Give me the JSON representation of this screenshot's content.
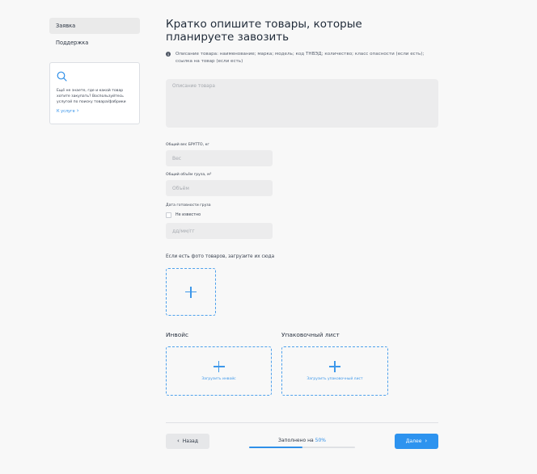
{
  "sidebar": {
    "items": [
      {
        "label": "Заявка"
      },
      {
        "label": "Поддержка"
      }
    ],
    "promo": {
      "icon": "search-icon",
      "text": "Ещё не знаете, где и какой товар хотите закупать? Воспользуйтесь услугой по поиску товара/фабрики",
      "link": "К услуге"
    }
  },
  "main": {
    "title": "Кратко опишите товары, которые планируете завозить",
    "hint": "Описание товара: наименование; марка; модель; код ТНВЭД; количество; класс опасности (если есть); ссылка на товар (если есть)",
    "description_placeholder": "Описание товара",
    "weight": {
      "label": "Общий вес БРУТТО, кг",
      "placeholder": "Вес"
    },
    "volume": {
      "label": "Общий объём груза, м³",
      "placeholder": "Объём"
    },
    "date": {
      "label": "Дата готовности груза",
      "checkbox_label": "Не известно",
      "placeholder": "дд/мм/гг"
    },
    "photo_label": "Если есть фото товаров, загрузите их сюда",
    "invoice": {
      "title": "Инвойс",
      "caption": "Загрузить инвойс"
    },
    "packing": {
      "title": "Упаковочный лист",
      "caption": "Загрузить упаковочный лист"
    }
  },
  "footer": {
    "back_label": "Назад",
    "progress_prefix": "Заполнено на",
    "progress_value": "50%",
    "progress_fraction": 0.5,
    "next_label": "Далее"
  },
  "colors": {
    "accent": "#2d93ef",
    "background": "#f8f8f8",
    "input_bg": "#ececed"
  }
}
